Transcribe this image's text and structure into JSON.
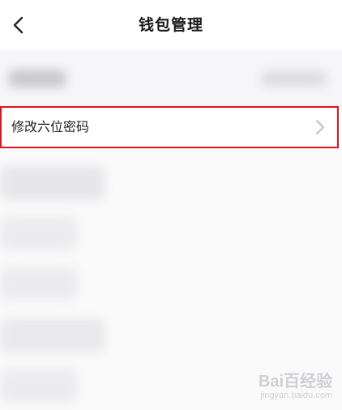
{
  "header": {
    "title": "钱包管理",
    "back_icon": "chevron-left-icon"
  },
  "menu": {
    "change_password_label": "修改六位密码",
    "chevron_icon": "chevron-right-icon",
    "highlight_color": "#e6121c"
  },
  "watermark": {
    "main": "Bai百经验",
    "sub": "jingyan.baidu.com"
  }
}
